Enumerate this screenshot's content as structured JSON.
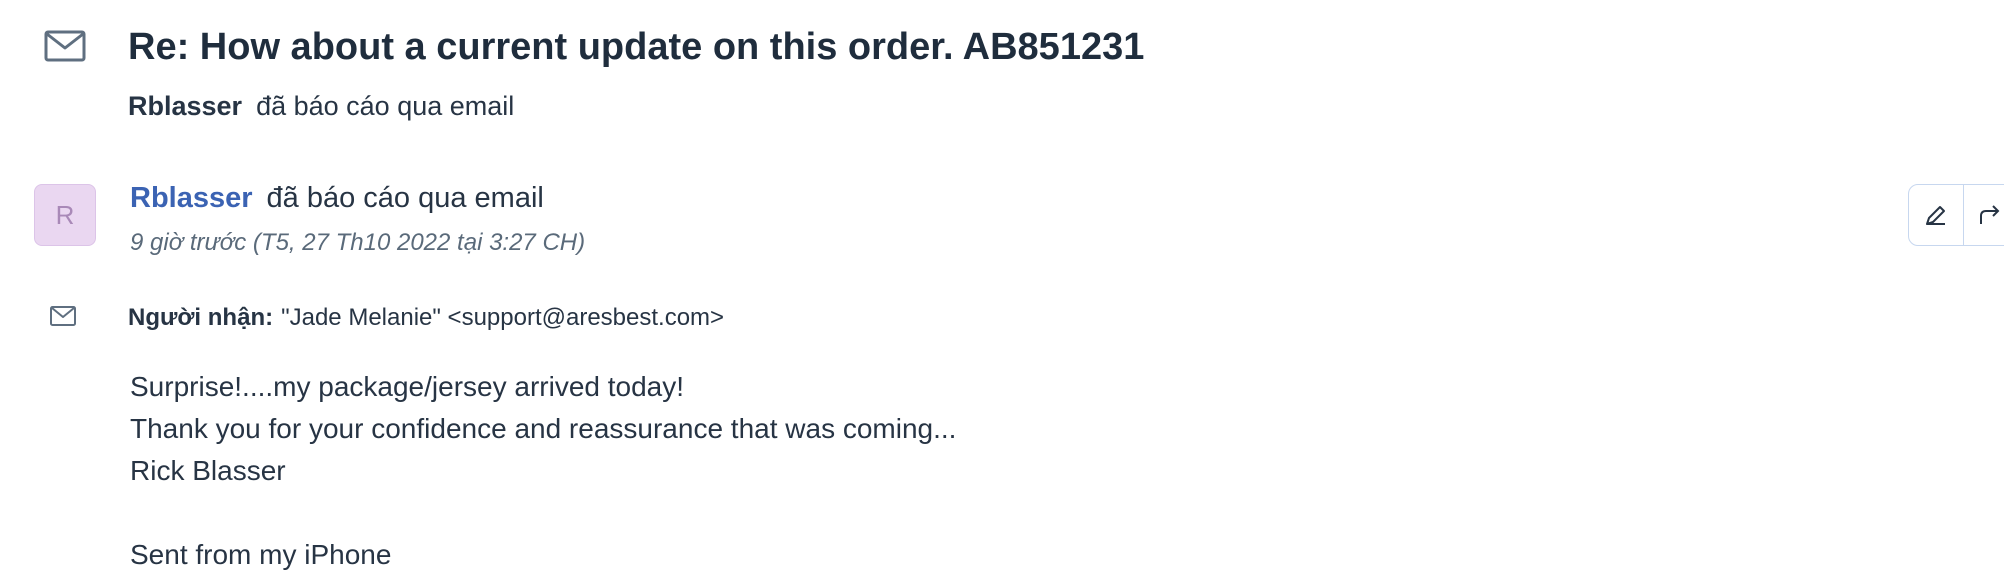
{
  "subject": "Re: How about a current update on this order. AB851231",
  "reported": {
    "who": "Rblasser",
    "action": "đã báo cáo qua email"
  },
  "message": {
    "avatar_letter": "R",
    "sender": "Rblasser",
    "action": "đã báo cáo qua email",
    "timestamp": "9 giờ trước (T5, 27 Th10 2022 tại 3:27 CH)",
    "recipient_label": "Người nhận:",
    "recipient_value": "\"Jade Melanie\" <support@aresbest.com>",
    "body_lines": [
      "Surprise!....my package/jersey arrived today!",
      "Thank you for your confidence and reassurance that was coming...",
      "Rick Blasser",
      "",
      "Sent from my iPhone"
    ]
  },
  "toolbar": {
    "edit_icon": "pencil-icon",
    "forward_icon": "forward-arrow-icon"
  },
  "colors": {
    "sender_link": "#3b63b3",
    "text": "#273444",
    "avatar_bg": "#ead7f1"
  }
}
